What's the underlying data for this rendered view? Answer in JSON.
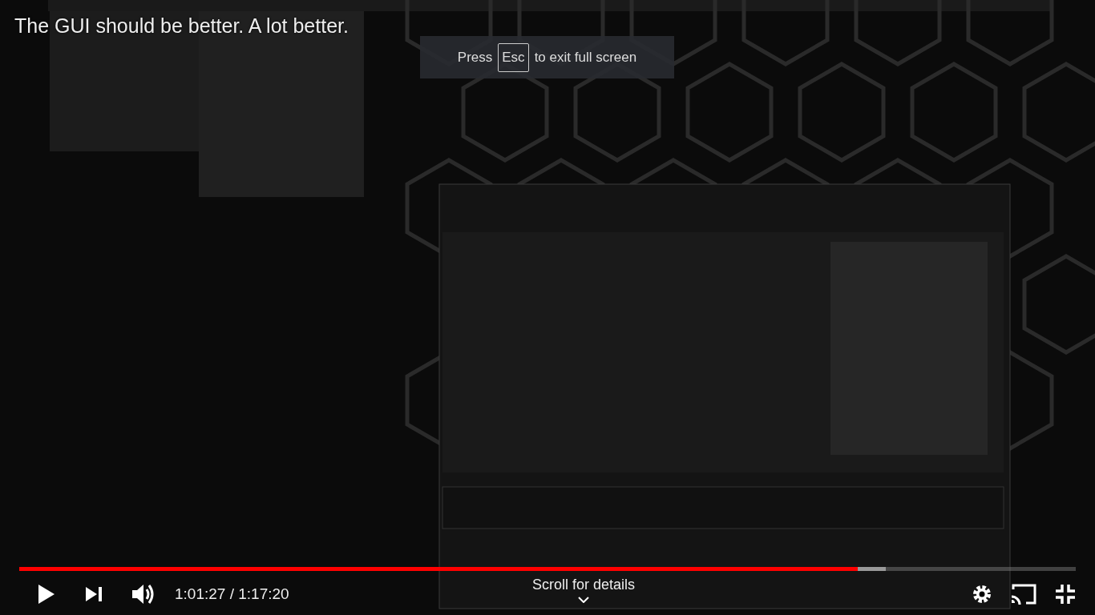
{
  "video": {
    "title": "The GUI should be better. A lot better."
  },
  "fullscreen_hint": {
    "before": "Press",
    "key": "Esc",
    "after": "to exit full screen"
  },
  "progress": {
    "level": 0.794
  },
  "buffer": {
    "level": 0.82
  },
  "controls": {
    "time": "1:01:27 / 1:17:20",
    "details": "Scroll for details"
  }
}
